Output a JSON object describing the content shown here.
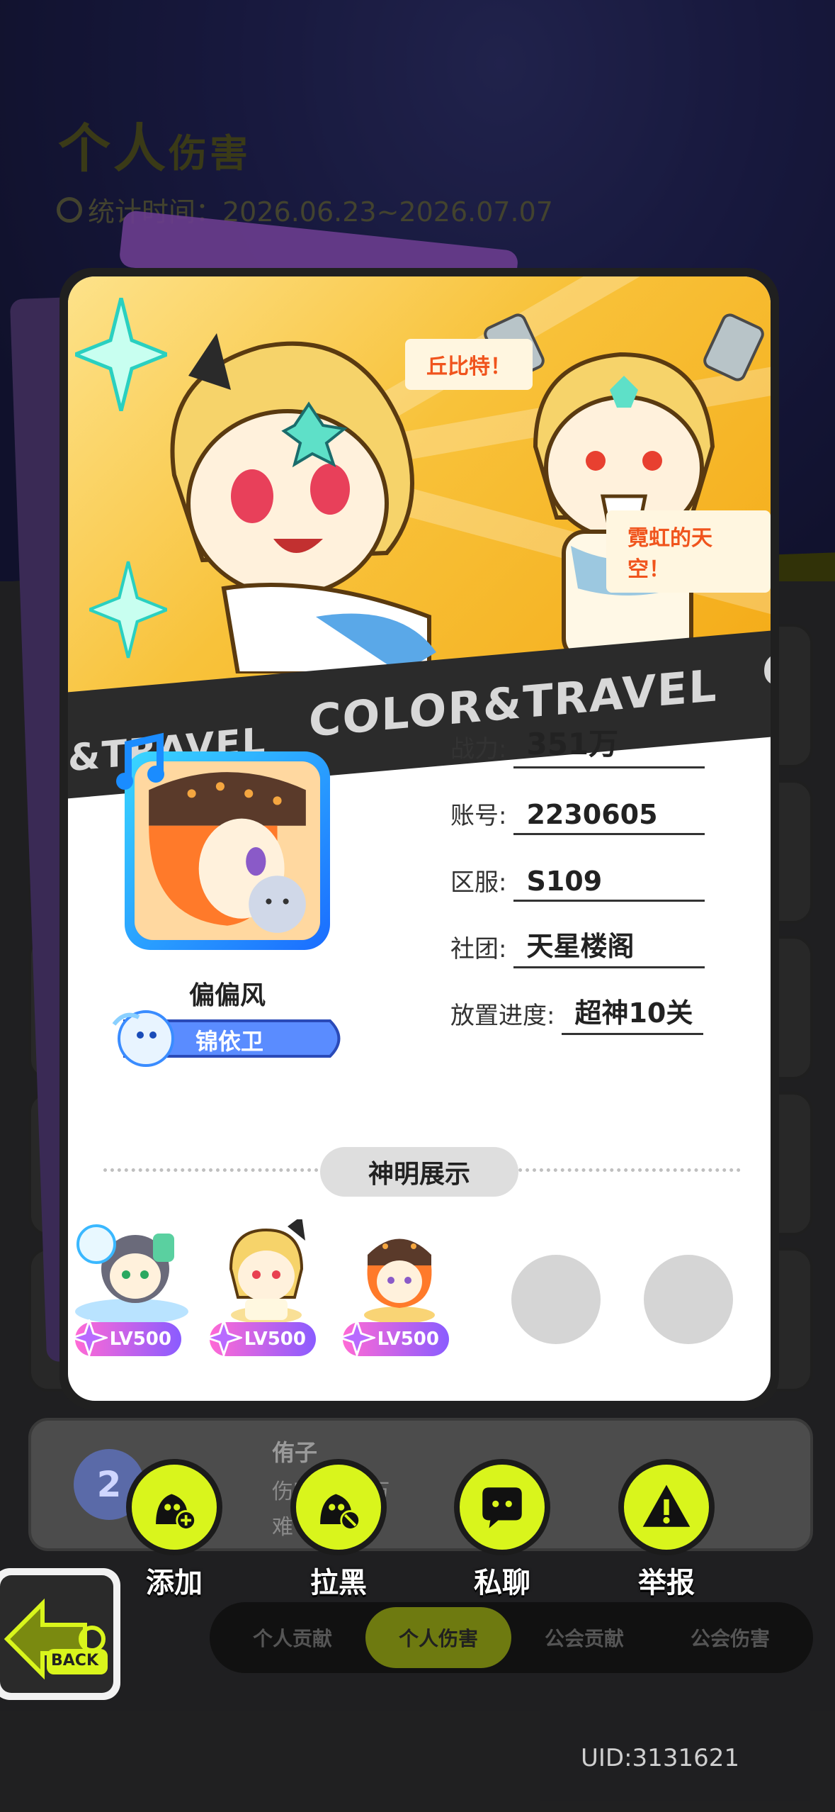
{
  "background": {
    "title_big": "个人",
    "title_small": "伤害",
    "stat_time": "统计时间：2026.06.23~2026.07.07"
  },
  "card": {
    "banner": {
      "bubble_1": "丘比特！",
      "bubble_2": "霓虹的天空！",
      "band_text_main": "COLOR&TRAVEL",
      "band_text_left": "&TRAVEL",
      "band_text_right": "CC"
    },
    "profile": {
      "name": "偏偏风",
      "title_badge": "锦依卫"
    },
    "info": [
      {
        "label": "战力:",
        "value": "351万"
      },
      {
        "label": "账号:",
        "value": "2230605"
      },
      {
        "label": "区服:",
        "value": "S109"
      },
      {
        "label": "社团:",
        "value": "天星楼阁"
      },
      {
        "label": "放置进度:",
        "value": "超神10关"
      }
    ],
    "section_title": "神明展示",
    "deities": [
      {
        "level": "LV500"
      },
      {
        "level": "LV500"
      },
      {
        "level": "LV500"
      }
    ]
  },
  "rank_row": {
    "rank": "2",
    "name": "侑子",
    "damage": "伤害1977万",
    "difficulty": "难"
  },
  "actions": [
    {
      "label": "添加",
      "icon": "add-friend-icon"
    },
    {
      "label": "拉黑",
      "icon": "block-icon"
    },
    {
      "label": "私聊",
      "icon": "chat-icon"
    },
    {
      "label": "举报",
      "icon": "warning-icon"
    }
  ],
  "back_button": {
    "label": "BACK"
  },
  "tabs": [
    {
      "label": "个人贡献"
    },
    {
      "label": "个人伤害"
    },
    {
      "label": "公会贡献"
    },
    {
      "label": "公会伤害"
    }
  ],
  "uid": "UID:3131621",
  "colors": {
    "accent_lime": "#d9f51c",
    "banner_yellow": "#f8c23a",
    "bubble_text": "#f0541d"
  }
}
